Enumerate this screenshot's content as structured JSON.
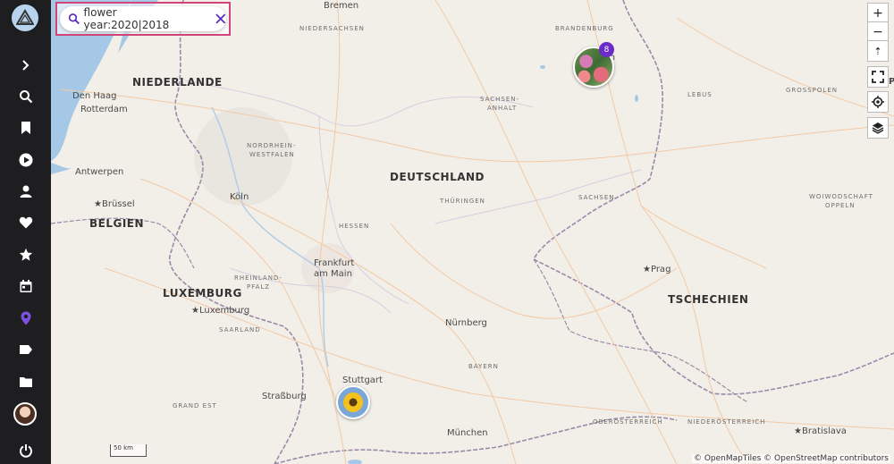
{
  "search": {
    "query": "flower year:2020|2018"
  },
  "sidebar": {
    "items": [
      {
        "name": "expand-icon",
        "label": ""
      },
      {
        "name": "search-icon",
        "label": ""
      },
      {
        "name": "bookmark-icon",
        "label": ""
      },
      {
        "name": "play-icon",
        "label": ""
      },
      {
        "name": "person-icon",
        "label": ""
      },
      {
        "name": "heart-icon",
        "label": ""
      },
      {
        "name": "star-icon",
        "label": ""
      },
      {
        "name": "calendar-icon",
        "label": ""
      },
      {
        "name": "map-pin-icon",
        "label": ""
      },
      {
        "name": "tag-icon",
        "label": ""
      },
      {
        "name": "folder-icon",
        "label": ""
      },
      {
        "name": "power-icon",
        "label": ""
      }
    ],
    "accent": "#7c52e0"
  },
  "map_controls": {
    "zoom_in": "+",
    "zoom_out": "−",
    "compass": "⇡",
    "fullscreen": "⛶",
    "locate": "◎",
    "layers": "≋"
  },
  "labels": {
    "bremen": "Bremen",
    "niedersachsen": "NIEDERSACHSEN",
    "brandenburg": "BRANDENBURG",
    "niederlande": "NIEDERLANDE",
    "den_haag": "Den Haag",
    "rotterdam": "Rotterdam",
    "sachsen_anhalt_1": "SACHSEN-",
    "sachsen_anhalt_2": "ANHALT",
    "lebus": "LEBUS",
    "grosspolen": "GROSSPOLEN",
    "nrw_1": "NORDRHEIN-",
    "nrw_2": "WESTFALEN",
    "antwerpen": "Antwerpen",
    "deutschland": "DEUTSCHLAND",
    "koln": "Köln",
    "thuringen": "THÜRINGEN",
    "sachsen": "SACHSEN",
    "woiwod_1": "WOIWODSCHAFT",
    "woiwod_2": "OPPELN",
    "brussel": "Brüssel",
    "belgien": "BELGIEN",
    "hessen": "HESSEN",
    "frankfurt_1": "Frankfurt",
    "frankfurt_2": "am Main",
    "prag": "Prag",
    "rlp_1": "RHEINLAND-",
    "rlp_2": "PFALZ",
    "luxemburg_country": "LUXEMBURG",
    "tschechien": "TSCHECHIEN",
    "luxemburg_city": "Luxemburg",
    "saarland": "SAARLAND",
    "nurnberg": "Nürnberg",
    "bayern": "BAYERN",
    "stuttgart": "Stuttgart",
    "strassburg": "Straßburg",
    "grand_est": "GRAND EST",
    "oberosterreich": "OBERÖSTERREICH",
    "niederosterreich": "NIEDERÖSTERREICH",
    "munchen": "München",
    "bratislava": "Bratislava",
    "berlin_fragment": "in",
    "edge_p": "P"
  },
  "clusters": [
    {
      "name": "berlin-cluster",
      "count": "8"
    },
    {
      "name": "stuttgart-sunflower",
      "count": ""
    }
  ],
  "scale": "50 km",
  "attribution": "© OpenMapTiles © OpenStreetMap contributors"
}
